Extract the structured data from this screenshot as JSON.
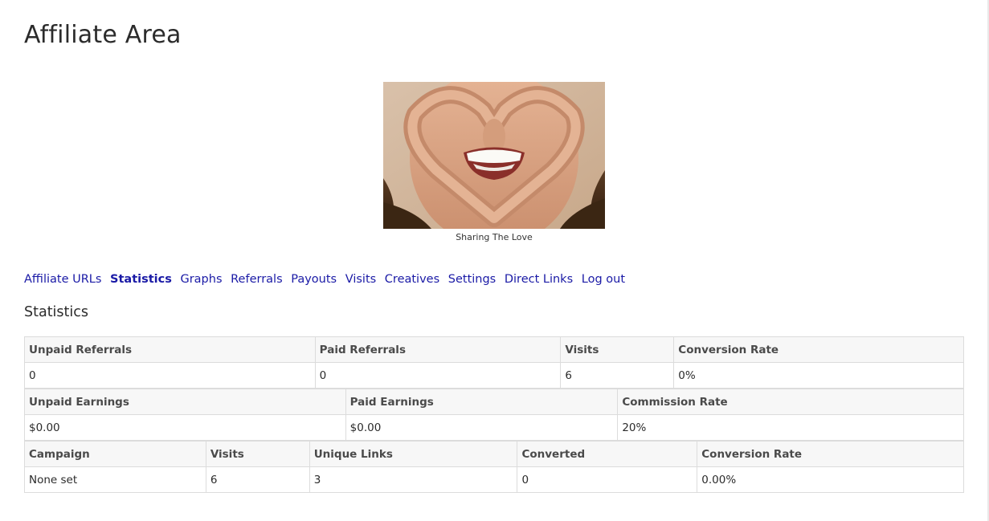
{
  "page": {
    "title": "Affiliate Area"
  },
  "banner": {
    "caption": "Sharing The Love"
  },
  "tabs": [
    {
      "label": "Affiliate URLs",
      "active": false
    },
    {
      "label": "Statistics",
      "active": true
    },
    {
      "label": "Graphs",
      "active": false
    },
    {
      "label": "Referrals",
      "active": false
    },
    {
      "label": "Payouts",
      "active": false
    },
    {
      "label": "Visits",
      "active": false
    },
    {
      "label": "Creatives",
      "active": false
    },
    {
      "label": "Settings",
      "active": false
    },
    {
      "label": "Direct Links",
      "active": false
    },
    {
      "label": "Log out",
      "active": false
    }
  ],
  "section": {
    "title": "Statistics"
  },
  "referral_table": {
    "headers": [
      "Unpaid Referrals",
      "Paid Referrals",
      "Visits",
      "Conversion Rate"
    ],
    "row": [
      "0",
      "0",
      "6",
      "0%"
    ]
  },
  "earnings_table": {
    "headers": [
      "Unpaid Earnings",
      "Paid Earnings",
      "Commission Rate"
    ],
    "row": [
      "$0.00",
      "$0.00",
      "20%"
    ]
  },
  "campaign_table": {
    "headers": [
      "Campaign",
      "Visits",
      "Unique Links",
      "Converted",
      "Conversion Rate"
    ],
    "row": [
      "None set",
      "6",
      "3",
      "0",
      "0.00%"
    ]
  },
  "colors": {
    "link": "#1a1aa6",
    "header_bg": "#f7f7f7",
    "border": "#dcdcdc"
  }
}
